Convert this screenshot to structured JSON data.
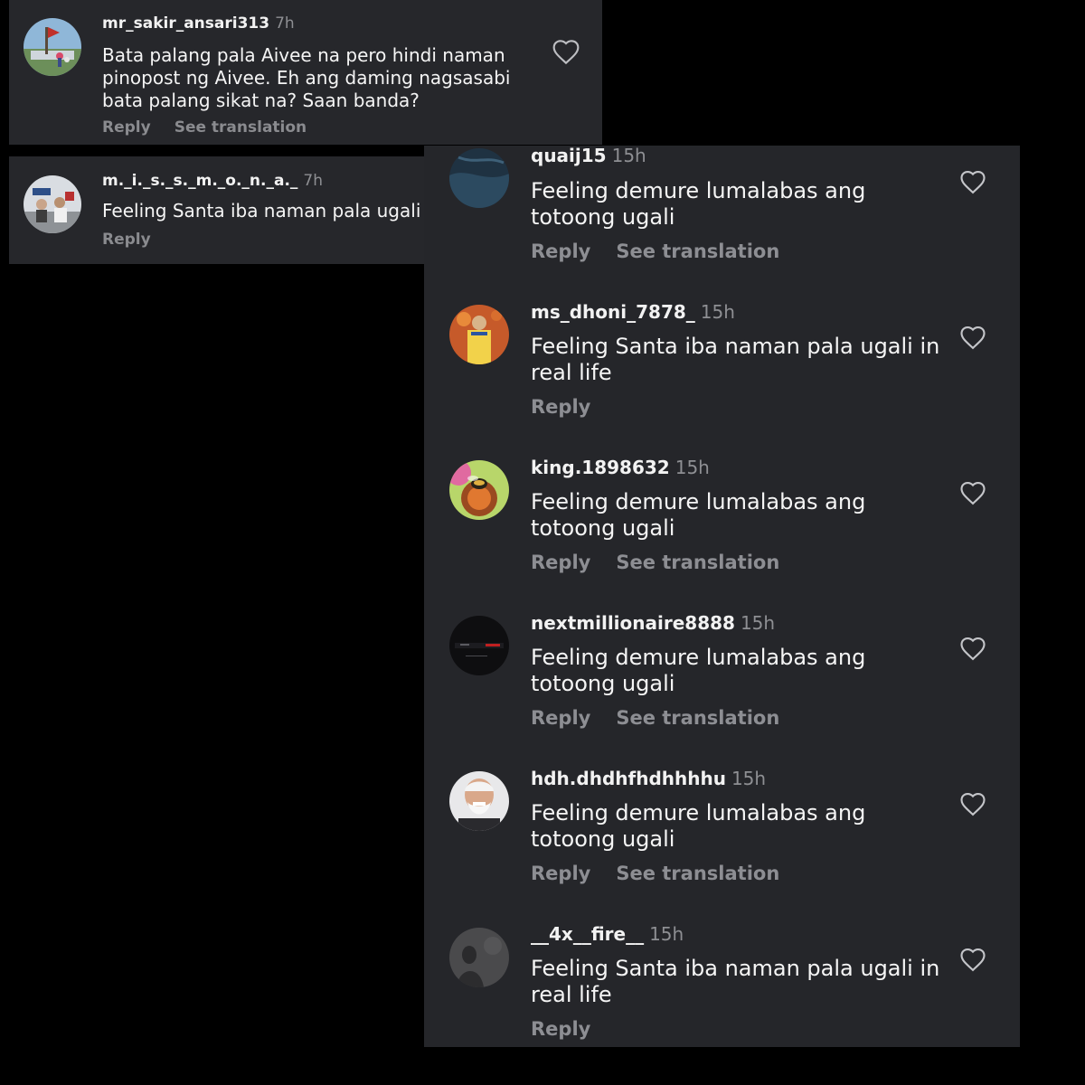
{
  "labels": {
    "reply": "Reply",
    "see_translation": "See translation"
  },
  "top_left": {
    "username": "mr_sakir_ansari313",
    "time": "7h",
    "text_lines": [
      "Bata palang pala Aivee na pero hindi naman",
      "pinopost ng Aivee. Eh ang daming nagsasabi",
      "bata palang sikat na? Saan banda?"
    ]
  },
  "middle_left": {
    "username": "m._i._s._s._m._o._n._a._",
    "time": "7h",
    "text_lines": [
      "Feeling Santa iba naman pala ugali i"
    ]
  },
  "comments": [
    {
      "username": "quaij15",
      "time": "15h",
      "text_lines": [
        "Feeling demure lumalabas ang",
        "totoong ugali"
      ],
      "avatar_icon": "denim-avatar-icon"
    },
    {
      "username": "ms_dhoni_7878_",
      "time": "15h",
      "text_lines": [
        "Feeling Santa iba naman pala ugali in",
        "real life"
      ],
      "avatar_icon": "cricketer-avatar-icon"
    },
    {
      "username": "king.1898632",
      "time": "15h",
      "text_lines": [
        "Feeling demure lumalabas ang",
        "totoong ugali"
      ],
      "avatar_icon": "bee-flower-avatar-icon"
    },
    {
      "username": "nextmillionaire8888",
      "time": "15h",
      "text_lines": [
        "Feeling demure lumalabas ang",
        "totoong ugali"
      ],
      "avatar_icon": "dark-car-avatar-icon"
    },
    {
      "username": "hdh.dhdhfhdhhhhu",
      "time": "15h",
      "text_lines": [
        "Feeling demure lumalabas ang",
        "totoong ugali"
      ],
      "avatar_icon": "old-man-avatar-icon"
    },
    {
      "username": "__4x__fire__",
      "time": "15h",
      "text_lines": [
        "Feeling Santa iba naman pala ugali in",
        "real life"
      ],
      "avatar_icon": "shadow-avatar-icon"
    }
  ]
}
